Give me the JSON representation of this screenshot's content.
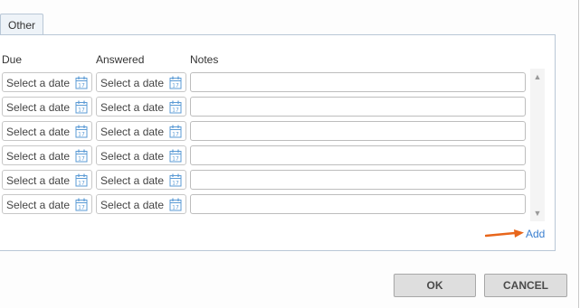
{
  "tabs": [
    {
      "label": "Other"
    }
  ],
  "columns": {
    "due": "Due",
    "answered": "Answered",
    "notes": "Notes"
  },
  "rows": [
    {
      "due_placeholder": "Select a date",
      "answered_placeholder": "Select a date",
      "notes": ""
    },
    {
      "due_placeholder": "Select a date",
      "answered_placeholder": "Select a date",
      "notes": ""
    },
    {
      "due_placeholder": "Select a date",
      "answered_placeholder": "Select a date",
      "notes": ""
    },
    {
      "due_placeholder": "Select a date",
      "answered_placeholder": "Select a date",
      "notes": ""
    },
    {
      "due_placeholder": "Select a date",
      "answered_placeholder": "Select a date",
      "notes": ""
    },
    {
      "due_placeholder": "Select a date",
      "answered_placeholder": "Select a date",
      "notes": ""
    }
  ],
  "add_link": "Add",
  "buttons": {
    "ok": "OK",
    "cancel": "CANCEL"
  },
  "icons": {
    "calendar": "calendar-icon",
    "scroll_up": "chevron-up-icon",
    "scroll_down": "chevron-down-icon",
    "arrow": "arrow-right-icon"
  },
  "colors": {
    "link": "#3a7fd0",
    "arrow": "#e8661b",
    "calendar": "#5b9bd5",
    "button_bg": "#dedede"
  }
}
